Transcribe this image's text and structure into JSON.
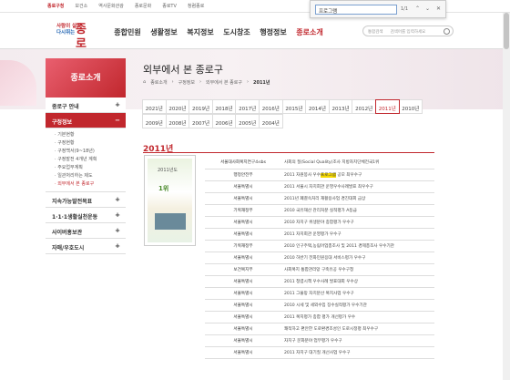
{
  "topbar": {
    "links": [
      "종로구청",
      "보건소",
      "역사문화관광",
      "종로문화",
      "종로TV",
      "청렴종로"
    ]
  },
  "logo": {
    "line1": "사람이 살맛",
    "line2": "다시뛰는",
    "name": "종로"
  },
  "gnb": [
    "종합민원",
    "생활정보",
    "복지정보",
    "도시창조",
    "행정정보",
    "종로소개"
  ],
  "search": {
    "label": "통합검색",
    "placeholder": "검색어를 입력하세요"
  },
  "findbar": {
    "value": "프로그램",
    "count": "1/1"
  },
  "side": {
    "title": "종로소개",
    "menus": [
      {
        "label": "종로구 안내",
        "sign": "+"
      },
      {
        "label": "구정정보",
        "sign": "−"
      }
    ],
    "subs": [
      "기본현황",
      "구정현황",
      "구정백서(9~18년)",
      "구정발전 4개년 계획",
      "주요업무계획",
      "일관처리하는 제도",
      "외부에서 본 종로구"
    ],
    "menus2": [
      {
        "label": "지속가능발전목표",
        "sign": "+"
      },
      {
        "label": "1·1·1생활실천운동",
        "sign": "+"
      },
      {
        "label": "사이버홍보관",
        "sign": "+"
      },
      {
        "label": "자매/우호도시",
        "sign": "+"
      }
    ]
  },
  "page": {
    "title": "외부에서 본 종로구",
    "crumbs": [
      "⌂",
      "종로소개",
      "구정정보",
      "외부에서 본 종로구",
      "2011년"
    ]
  },
  "years": [
    [
      "2021년",
      "2020년",
      "2019년",
      "2018년",
      "2017년",
      "2016년",
      "2015년",
      "2014년",
      "2013년",
      "2012년",
      "2011년",
      "2010년"
    ],
    [
      "2009년",
      "2008년",
      "2007년",
      "2006년",
      "2005년",
      "2004년"
    ]
  ],
  "selected_year": "2011년",
  "book": {
    "top": "2011년도",
    "mid": "1위"
  },
  "awards": [
    [
      "서울대사회복지연구소sbs",
      "사회의 질(Social Quality)조사 지방자치단체전국1위"
    ],
    [
      "행정안전부",
      "2011 자원봉사 우수",
      "프로그램",
      "공모 최우수구"
    ],
    [
      "서울특별시",
      "2011 서울시 자치회관 운영우수사례발표 최우수구"
    ],
    [
      "서울특별시",
      "2011년 폐결속처리 재활용사업 경진대회 금상"
    ],
    [
      "기획재정부",
      "2010 국유재산 관리처분 실적평가 A등급"
    ],
    [
      "서울특별시",
      "2010 자치구 위생분야 종합평가 우수구"
    ],
    [
      "서울특별시",
      "2011 자치회관 운영평가 우수구"
    ],
    [
      "기획재정부",
      "2010 인구주택,농림어업총조사 및 2011 경제총조사 우수기관"
    ],
    [
      "서울특별시",
      "2010 하반기 전화민원응대 서비스평가 우수구"
    ],
    [
      "보건복지부",
      "사회복지 통합관리망 구축유공 우수구청"
    ],
    [
      "서울특별시",
      "2011 청렴시책 우수사례 발표대회 우수상"
    ],
    [
      "서울특별시",
      "2011 그물망 자치분산 복지사업 우수구"
    ],
    [
      "서울특별시",
      "2010 시세 및 세외수입 징수실적평가 우수기관"
    ],
    [
      "서울특별시",
      "2011 복지평가 종합 평가 개선평가 우수"
    ],
    [
      "서울특별시",
      "쾌적하고 편안한 도로환경조성인 도로시정평 최우수구"
    ],
    [
      "서울특별시",
      "자치구 문화분야 업무평가 우수구"
    ],
    [
      "서울특별시",
      "2011 자치구 대기질 개선사업 우수구"
    ]
  ]
}
